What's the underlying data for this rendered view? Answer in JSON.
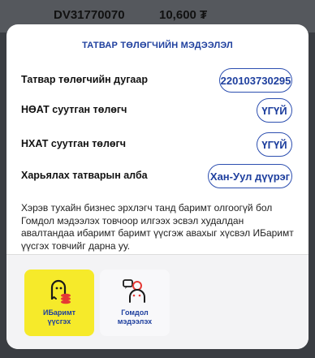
{
  "background_row": {
    "code": "DV31770070",
    "amount": "10,600 ₮"
  },
  "modal": {
    "title": "ТАТВАР ТӨЛӨГЧИЙН МЭДЭЭЛЭЛ",
    "rows": [
      {
        "label": "Татвар төлөгчийн дугаар",
        "value": "220103730295"
      },
      {
        "label": "НӨАТ суутган төлөгч",
        "value": "ҮГҮЙ"
      },
      {
        "label": "НХАТ суутган төлөгч",
        "value": "ҮГҮЙ"
      },
      {
        "label": "Харьялах татварын алба",
        "value": "Хан-Уул дүүрэг"
      }
    ],
    "description": "Хэрэв тухайн бизнес эрхлэгч танд баримт олгоогүй бол Гомдол мэдээлэх товчоор илгээх эсвэл худалдан авалтандаа ибаримт баримт үүсгэж авахыг хүсвэл ИБаримт үүсгэх товчийг дарна уу.",
    "actions": [
      {
        "label": "ИБаримт\nүүсгэх",
        "icon": "receipt-coins-icon"
      },
      {
        "label": "Гомдол\nмэдээлэх",
        "icon": "complaint-person-icon"
      }
    ]
  },
  "colors": {
    "accent": "#1e3f9e",
    "primary_button": "#f6ea2a",
    "overlay": "#3a3d42"
  }
}
